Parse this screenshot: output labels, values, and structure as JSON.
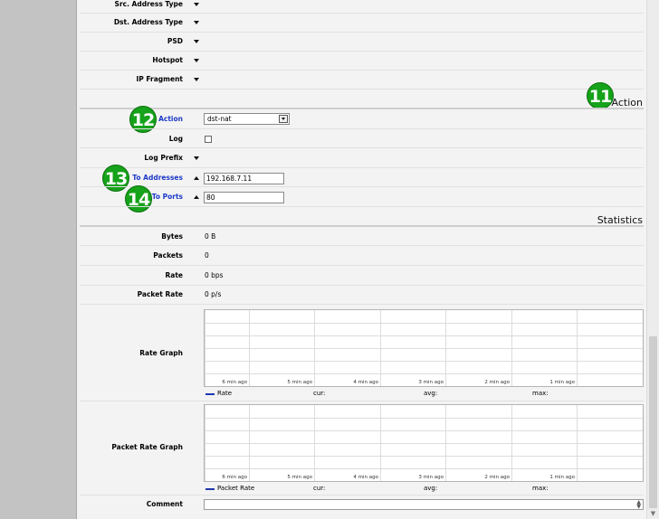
{
  "fields_top": [
    {
      "label": "Src. Address Type"
    },
    {
      "label": "Dst. Address Type"
    },
    {
      "label": "PSD"
    },
    {
      "label": "Hotspot"
    },
    {
      "label": "IP Fragment"
    }
  ],
  "sections": {
    "action": "Action",
    "statistics": "Statistics"
  },
  "badges": {
    "b11": "11",
    "b12": "12",
    "b13": "13",
    "b14": "14"
  },
  "action": {
    "action_label": "Action",
    "action_value": "dst-nat",
    "log_label": "Log",
    "log_checked": false,
    "log_prefix_label": "Log Prefix",
    "to_addresses_label": "To Addresses",
    "to_addresses_value": "192.168.7.11",
    "to_ports_label": "To Ports",
    "to_ports_value": "80"
  },
  "stats": [
    {
      "label": "Bytes",
      "value": "0 B"
    },
    {
      "label": "Packets",
      "value": "0"
    },
    {
      "label": "Rate",
      "value": "0 bps"
    },
    {
      "label": "Packet Rate",
      "value": "0 p/s"
    }
  ],
  "rate_graph": {
    "label": "Rate Graph",
    "ticks": [
      "6 min ago",
      "5 min ago",
      "4 min ago",
      "3 min ago",
      "2 min ago",
      "1 min ago"
    ],
    "legend": {
      "series": "Rate",
      "cur": "cur:",
      "avg": "avg:",
      "max": "max:"
    },
    "series_color": "#2037b0"
  },
  "packet_rate_graph": {
    "label": "Packet Rate Graph",
    "ticks": [
      "6 min ago",
      "5 min ago",
      "4 min ago",
      "3 min ago",
      "2 min ago",
      "1 min ago"
    ],
    "legend": {
      "series": "Packet Rate",
      "cur": "cur:",
      "avg": "avg:",
      "max": "max:"
    },
    "series_color": "#2037b0"
  },
  "comment": {
    "label": "Comment",
    "value": ""
  },
  "colors": {
    "badge": "#16a21a",
    "link_label": "#1d39c9",
    "gutter": "#c3c3c3",
    "panel": "#f3f3f3"
  }
}
